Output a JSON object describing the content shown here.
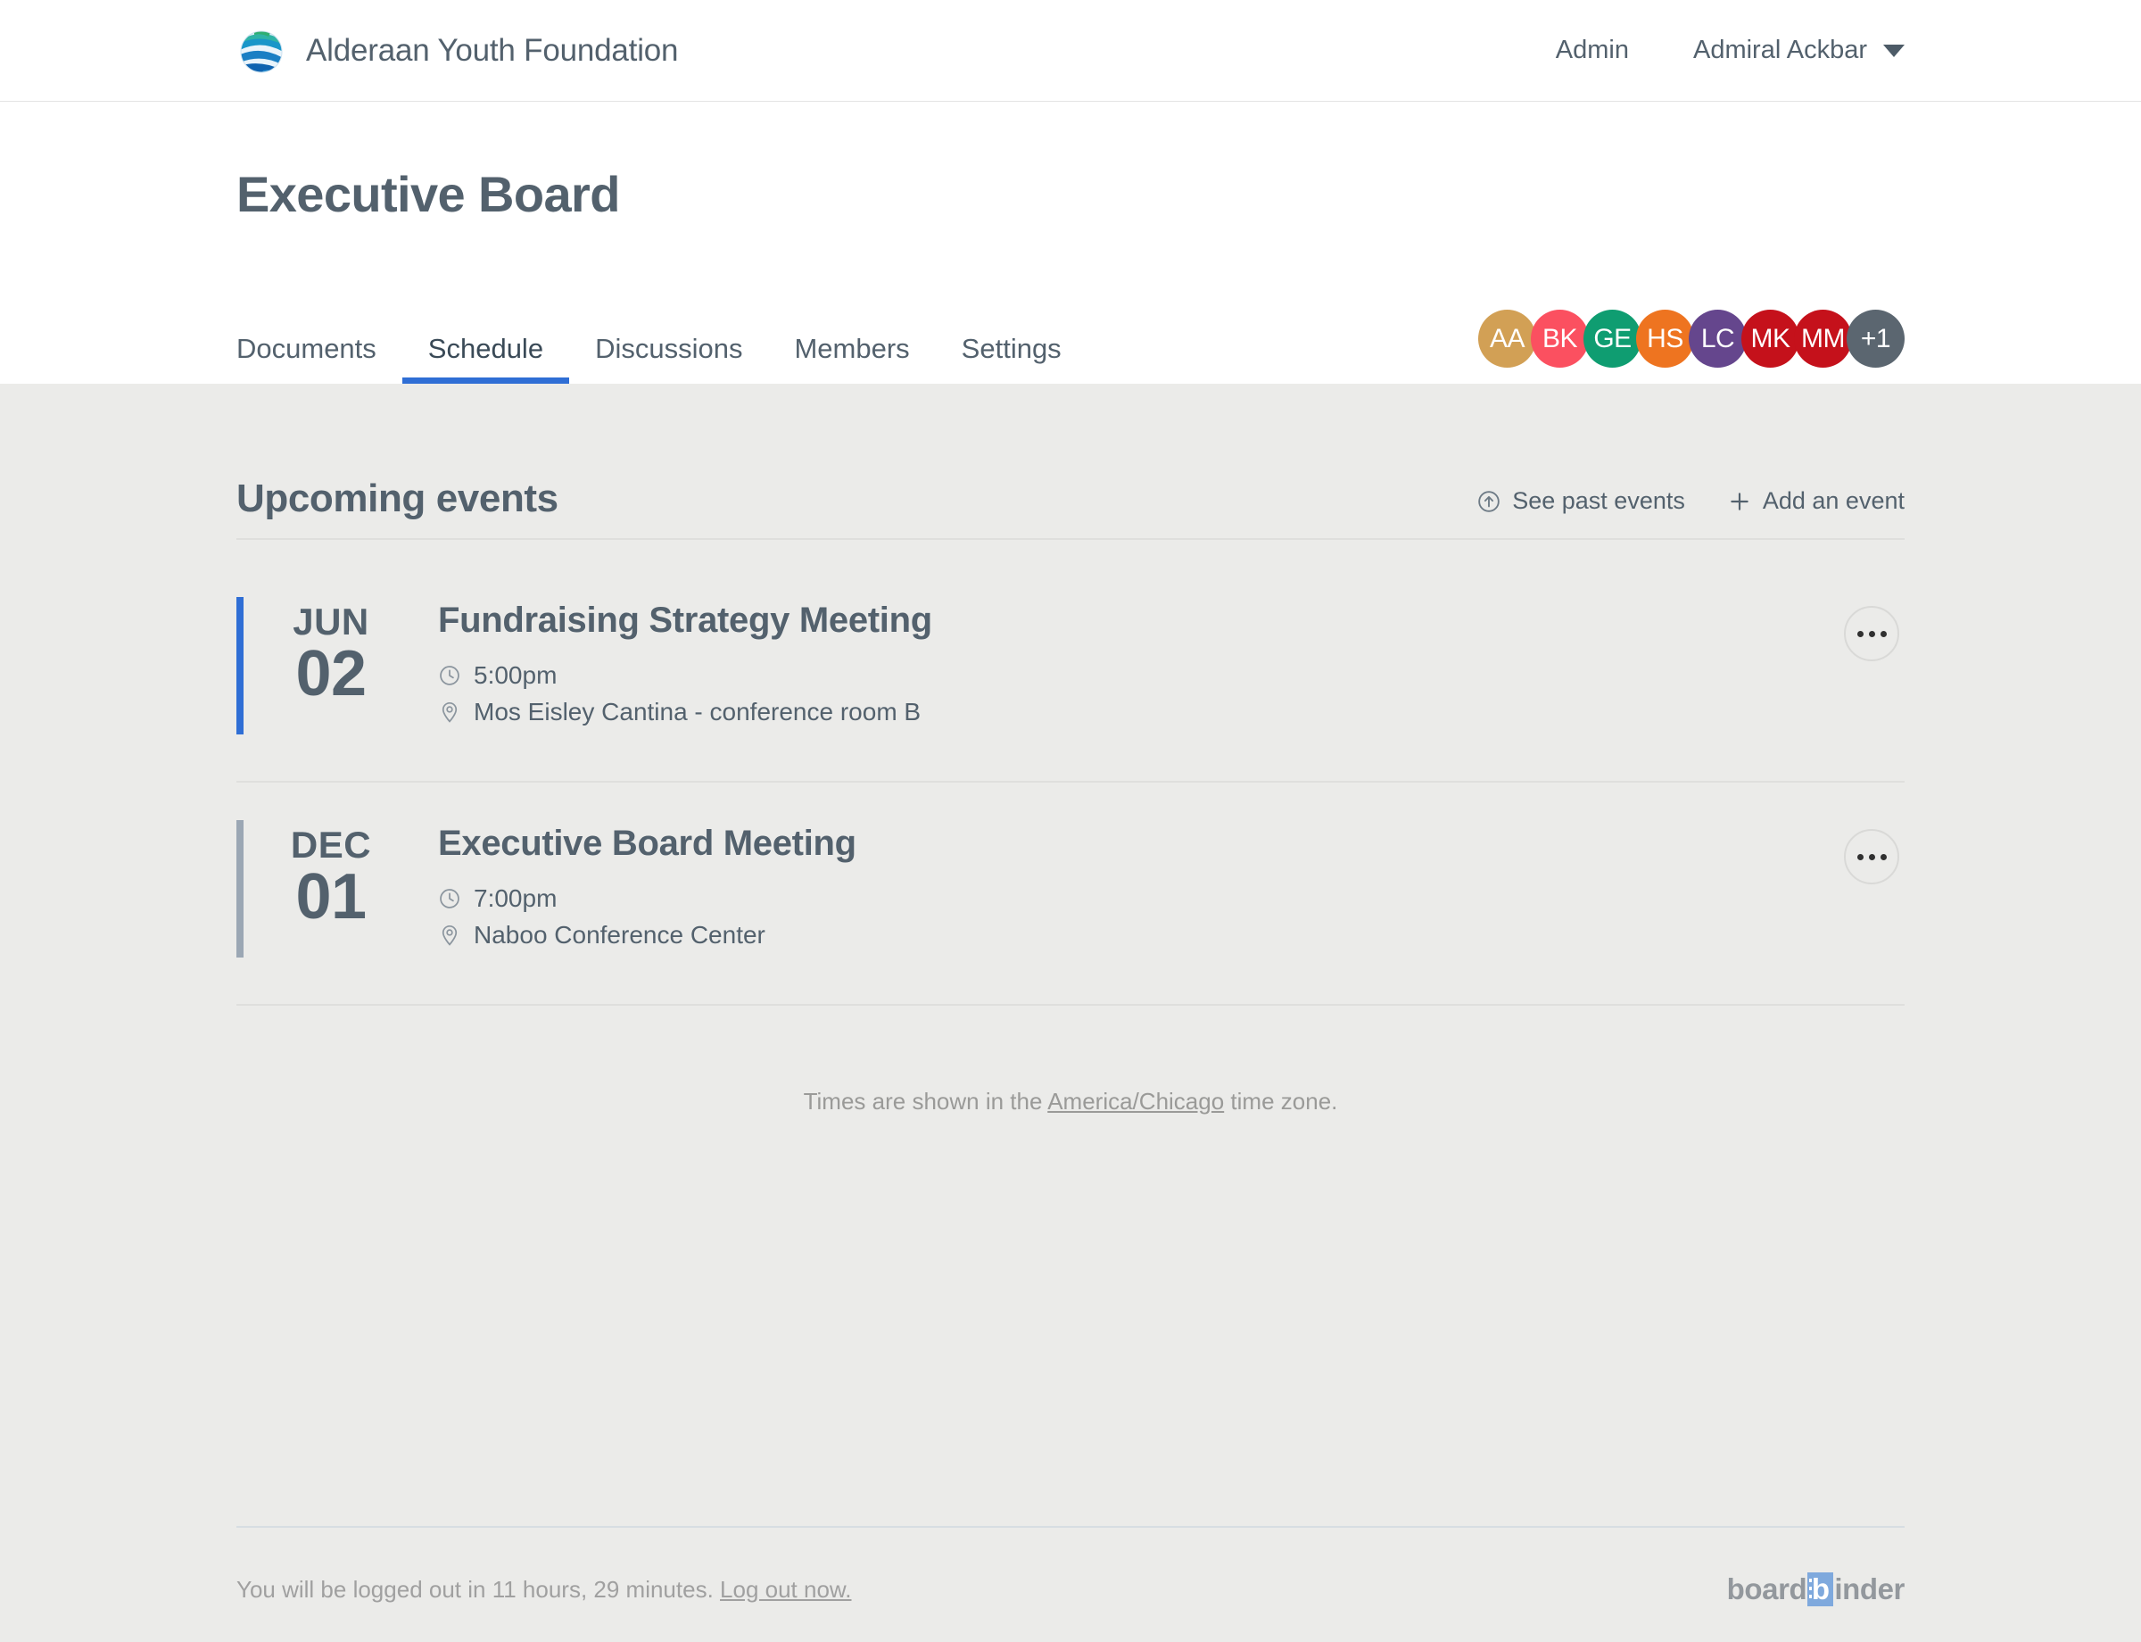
{
  "topbar": {
    "brand_name": "Alderaan Youth Foundation",
    "logo_icon": "globe-icon",
    "admin_label": "Admin",
    "user_name": "Admiral Ackbar",
    "caret_icon": "chevron-down-icon"
  },
  "page": {
    "title": "Executive Board"
  },
  "tabs": [
    {
      "label": "Documents",
      "active": false
    },
    {
      "label": "Schedule",
      "active": true
    },
    {
      "label": "Discussions",
      "active": false
    },
    {
      "label": "Members",
      "active": false
    },
    {
      "label": "Settings",
      "active": false
    }
  ],
  "members": [
    {
      "initials": "AA",
      "color": "#d2a055"
    },
    {
      "initials": "BK",
      "color": "#fb5060"
    },
    {
      "initials": "GE",
      "color": "#0f9d71"
    },
    {
      "initials": "HS",
      "color": "#ee7420"
    },
    {
      "initials": "LC",
      "color": "#65468d"
    },
    {
      "initials": "MK",
      "color": "#c5111b"
    },
    {
      "initials": "MM",
      "color": "#c5111b"
    },
    {
      "initials": "+1",
      "color": "#5b6670"
    }
  ],
  "schedule": {
    "section_title": "Upcoming events",
    "see_past_label": "See past events",
    "see_past_icon": "circle-arrow-up-icon",
    "add_event_label": "Add an event",
    "add_event_icon": "plus-icon",
    "menu_icon": "ellipsis-icon",
    "clock_icon": "clock-icon",
    "location_icon": "map-pin-icon",
    "events": [
      {
        "month": "JUN",
        "day": "02",
        "name": "Fundraising Strategy Meeting",
        "time": "5:00pm",
        "location": "Mos Eisley Cantina - conference room B",
        "accent_color": "#2f6ed5"
      },
      {
        "month": "DEC",
        "day": "01",
        "name": "Executive Board Meeting",
        "time": "7:00pm",
        "location": "Naboo Conference Center",
        "accent_color": "#9ba7b4"
      }
    ],
    "timezone_note_prefix": "Times are shown in the ",
    "timezone_link": "America/Chicago",
    "timezone_note_suffix": " time zone."
  },
  "footer": {
    "logout_text": "You will be logged out in 11 hours, 29 minutes. ",
    "logout_link": "Log out now.",
    "brand_part1": "board",
    "brand_badge": "b",
    "brand_part2": "inder"
  }
}
